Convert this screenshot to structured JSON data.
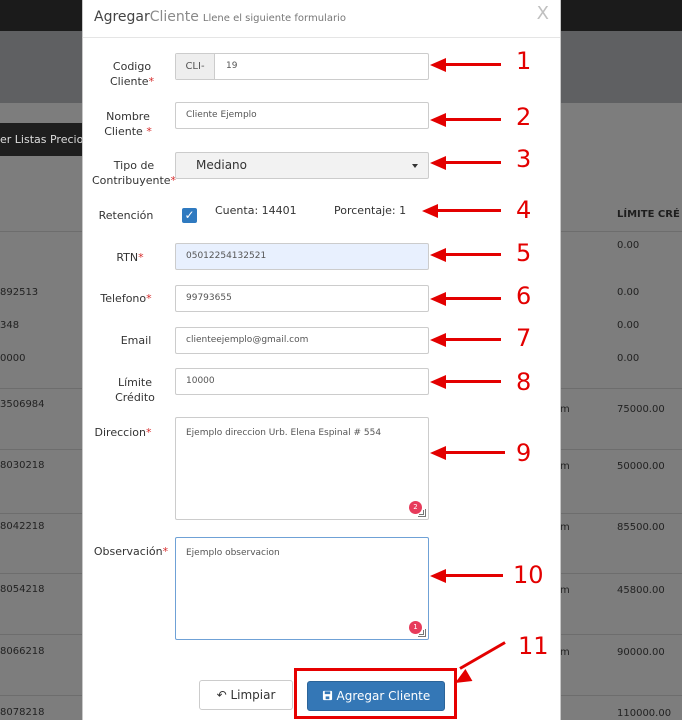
{
  "background": {
    "listas_label": "er Listas Precios",
    "limite_header": "LÍMITE CRÉ",
    "left_cells": [
      "892513",
      "348",
      "0000",
      "3506984",
      "8030218",
      "8042218",
      "8054218",
      "8066218",
      "8078218"
    ],
    "right_cells": [
      "0.00",
      "0.00",
      "0.00",
      "0.00",
      "75000.00",
      "50000.00",
      "85500.00",
      "45800.00",
      "90000.00",
      "110000.00"
    ],
    "mid_cells": [
      "m",
      "m",
      "m",
      "m",
      "m"
    ]
  },
  "modal": {
    "title_strong": "Agregar",
    "title_accent": "Cliente",
    "subtitle": "Llene el siguiente formulario",
    "close": "X"
  },
  "form": {
    "codigo_label_1": "Codigo",
    "codigo_label_2": "Cliente",
    "codigo_prefix": "CLI-",
    "codigo_value": "19",
    "nombre_label_1": "Nombre",
    "nombre_label_2": "Cliente",
    "nombre_value": "Cliente Ejemplo",
    "tipo_label_1": "Tipo de",
    "tipo_label_2": "Contribuyente",
    "tipo_value": "Mediano",
    "retencion_label": "Retención",
    "retencion_cuenta": "Cuenta: 14401",
    "retencion_porcentaje": "Porcentaje: 1",
    "rtn_label": "RTN",
    "rtn_value": "05012254132521",
    "telefono_label": "Telefono",
    "telefono_value": "99793655",
    "email_label": "Email",
    "email_value": "clienteejemplo@gmail.com",
    "limite_label_1": "Límite",
    "limite_label_2": "Crédito",
    "limite_value": "10000",
    "direccion_label": "Direccion",
    "direccion_value": "Ejemplo direccion Urb. Elena Espinal # 554",
    "direccion_badge": "2",
    "observacion_label": "Observación",
    "observacion_value": "Ejemplo observacion",
    "observacion_badge": "1",
    "required_mark": "*"
  },
  "buttons": {
    "limpiar_icon": "↶",
    "limpiar": "Limpiar",
    "agregar_icon": "save-icon",
    "agregar": "Agregar Cliente"
  },
  "annotations": [
    "1",
    "2",
    "3",
    "4",
    "5",
    "6",
    "7",
    "8",
    "9",
    "10",
    "11"
  ],
  "colors": {
    "accent_red": "#e30000",
    "primary_button": "#3477b6",
    "checkbox_blue": "#2f7ac0",
    "required_red": "#d62b2b"
  }
}
